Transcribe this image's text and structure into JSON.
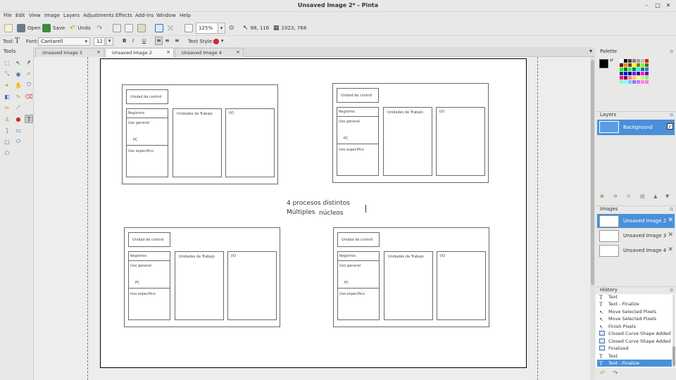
{
  "window": {
    "title": "Unsaved Image 2* - Pinta"
  },
  "menu": [
    "File",
    "Edit",
    "View",
    "Image",
    "Layers",
    "Adjustments",
    "Effects",
    "Add-ins",
    "Window",
    "Help"
  ],
  "toolbar": {
    "open": "Open",
    "save": "Save",
    "undo": "Undo",
    "zoom": "125%",
    "cursor_pos": "98, 116",
    "image_size": "1023, 768"
  },
  "textbar": {
    "tool_label": "Tool:",
    "font_label": "Font:",
    "font_value": "Cantarell",
    "size_value": "12",
    "bold": "B",
    "italic": "I",
    "underline": "U",
    "text_style_label": "Text Style:"
  },
  "tools_header": "Tools",
  "tabs": [
    {
      "label": "Unsaved Image 3"
    },
    {
      "label": "Unsaved Image 2"
    },
    {
      "label": "Unsaved Image 4"
    }
  ],
  "canvas": {
    "center_line1": "4 procesos distintos",
    "center_line2": "Múltiples",
    "center_line2b": "núcleos",
    "blocks": [
      {
        "control": "Unidad de control",
        "registers": "Registros",
        "general": "Uso general",
        "pc": "PC",
        "specific": "Uso específico",
        "units": "Unidades de Trabajo",
        "io": "I/O"
      },
      {
        "control": "Unidad de control",
        "registers": "Registros",
        "general": "Uso general",
        "pc": "PC",
        "specific": "Uso específico",
        "units": "Unidades de Trabajo",
        "io": "I/O"
      },
      {
        "control": "Unidad de control",
        "registers": "Registros",
        "general": "Uso general",
        "pc": "PC",
        "specific": "Uso específico",
        "units": "Unidades de Trabajo",
        "io": "I/O"
      },
      {
        "control": "Unidad de control",
        "registers": "Registros",
        "general": "Uso general",
        "pc": "PC",
        "specific": "Uso específico",
        "units": "Unidades de Trabajo",
        "io": "I/O"
      }
    ]
  },
  "palette": {
    "header": "Palette",
    "primary": "#000000",
    "secondary": "#ffffff"
  },
  "layers": {
    "header": "Layers",
    "items": [
      {
        "name": "Background"
      }
    ]
  },
  "images": {
    "header": "Images",
    "items": [
      "Unsaved Image 2",
      "Unsaved Image 3",
      "Unsaved Image 4"
    ]
  },
  "history": {
    "header": "History",
    "items": [
      "Text",
      "Text - Finalize",
      "Move Selected Pixels",
      "Move Selected Pixels",
      "Finish Pixels",
      "Closed Curve Shape Added",
      "Closed Curve Shape Added",
      "Finalized",
      "Text",
      "Text - Finalize"
    ]
  },
  "colors": {
    "accent": "#4a90d9"
  }
}
